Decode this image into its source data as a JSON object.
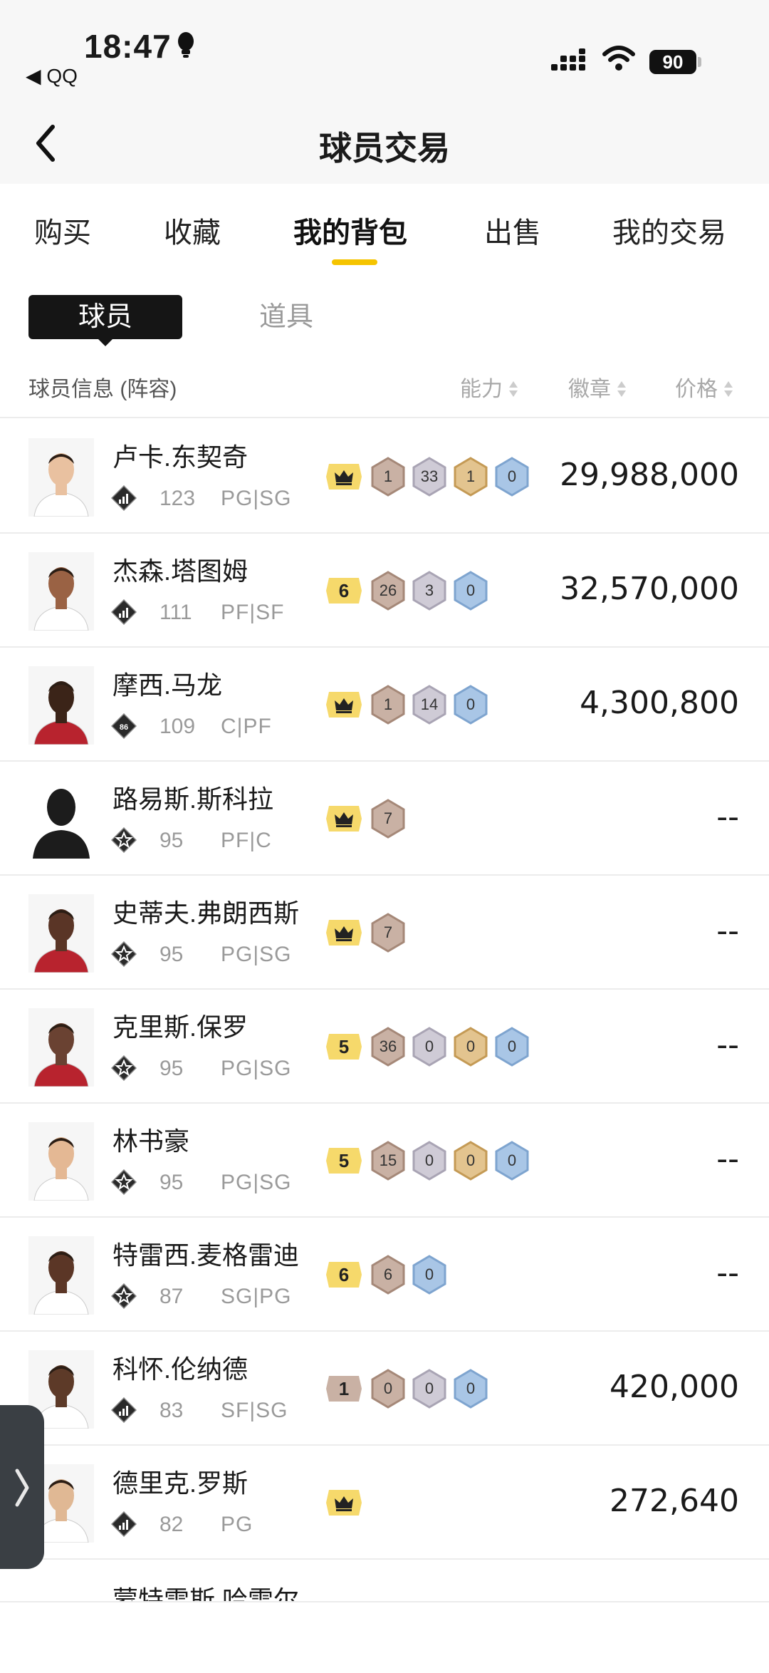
{
  "status_bar": {
    "time": "18:47",
    "back_app": "◀ QQ",
    "battery": "90"
  },
  "header": {
    "title": "球员交易"
  },
  "tabs": [
    {
      "label": "购买",
      "active": false
    },
    {
      "label": "收藏",
      "active": false
    },
    {
      "label": "我的背包",
      "active": true
    },
    {
      "label": "出售",
      "active": false
    },
    {
      "label": "我的交易",
      "active": false
    }
  ],
  "sub_tabs": {
    "players": "球员",
    "items": "道具"
  },
  "columns": {
    "info": "球员信息 (阵容)",
    "ability": "能力",
    "badges": "徽章",
    "price": "价格"
  },
  "players": [
    {
      "name": "卢卡.东契奇",
      "overall": "123",
      "positions": "PG|SG",
      "tier": "bars",
      "level": "crown",
      "badges": [
        "1",
        "33",
        "1",
        "0"
      ],
      "price": "29,988,000"
    },
    {
      "name": "杰森.塔图姆",
      "overall": "111",
      "positions": "PF|SF",
      "tier": "bars",
      "level": "6",
      "badges": [
        "26",
        "3",
        "0"
      ],
      "price": "32,570,000"
    },
    {
      "name": "摩西.马龙",
      "overall": "109",
      "positions": "C|PF",
      "tier": "86",
      "level": "crown",
      "badges": [
        "1",
        "14",
        "0"
      ],
      "price": "4,300,800"
    },
    {
      "name": "路易斯.斯科拉",
      "overall": "95",
      "positions": "PF|C",
      "tier": "star",
      "level": "crown",
      "badges": [
        "7"
      ],
      "price": "--"
    },
    {
      "name": "史蒂夫.弗朗西斯",
      "overall": "95",
      "positions": "PG|SG",
      "tier": "star",
      "level": "crown",
      "badges": [
        "7"
      ],
      "price": "--"
    },
    {
      "name": "克里斯.保罗",
      "overall": "95",
      "positions": "PG|SG",
      "tier": "star",
      "level": "5",
      "badges": [
        "36",
        "0",
        "0",
        "0"
      ],
      "price": "--"
    },
    {
      "name": "林书豪",
      "overall": "95",
      "positions": "PG|SG",
      "tier": "star",
      "level": "5",
      "badges": [
        "15",
        "0",
        "0",
        "0"
      ],
      "price": "--"
    },
    {
      "name": "特雷西.麦格雷迪",
      "overall": "87",
      "positions": "SG|PG",
      "tier": "star",
      "level": "6",
      "badges": [
        "6",
        "0"
      ],
      "price": "--"
    },
    {
      "name": "科怀.伦纳德",
      "overall": "83",
      "positions": "SF|SG",
      "tier": "bars",
      "level": "1",
      "badges": [
        "0",
        "0",
        "0"
      ],
      "price": "420,000"
    },
    {
      "name": "德里克.罗斯",
      "overall": "82",
      "positions": "PG",
      "tier": "bars",
      "level": "crown",
      "badges": [],
      "price": "272,640"
    },
    {
      "name": "蒙特雷斯.哈雷尔"
    }
  ]
}
